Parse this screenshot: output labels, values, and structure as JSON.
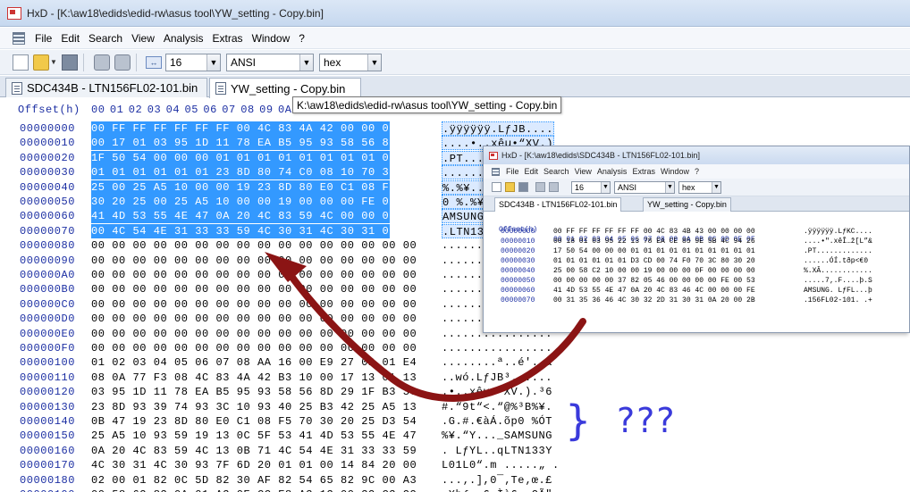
{
  "window": {
    "title": "HxD - [K:\\aw18\\edids\\edid-rw\\asus tool\\YW_setting - Copy.bin]"
  },
  "menu": [
    "File",
    "Edit",
    "Search",
    "View",
    "Analysis",
    "Extras",
    "Window",
    "?"
  ],
  "toolbar": {
    "bytes_per_row": "16",
    "charset": "ANSI",
    "display_mode": "hex"
  },
  "tabs": [
    {
      "label": "SDC434B - LTN156FL02-101.bin",
      "active": false
    },
    {
      "label": "YW_setting - Copy.bin",
      "active": true
    }
  ],
  "tooltip": "K:\\aw18\\edids\\edid-rw\\asus tool\\YW_setting - Copy.bin",
  "hex_view": {
    "offset_header": "Offset(h)",
    "column_headers": [
      "00",
      "01",
      "02",
      "03",
      "04",
      "05",
      "06",
      "07",
      "08",
      "09",
      "0A",
      "0B",
      "0C",
      "0D",
      "0E",
      "0F"
    ],
    "rows": [
      {
        "offset": "00000000",
        "bytes": "00 FF FF FF FF FF FF 00 4C 83 4A 42 00 00 00 00",
        "ascii": ".ÿÿÿÿÿÿ.LƒJB....",
        "selected": true
      },
      {
        "offset": "00000010",
        "bytes": "00 17 01 03 95 1D 11 78 EA B5 95 93 58 56 8D 29",
        "ascii": "....•..xêµ•“XV.)",
        "selected": true
      },
      {
        "offset": "00000020",
        "bytes": "1F 50 54 00 00 00 01 01 01 01 01 01 01 01 01 01",
        "ascii": ".PT.............",
        "selected": true
      },
      {
        "offset": "00000030",
        "bytes": "01 01 01 01 01 01 23 8D 80 74 C0 08 10 70 30 20",
        "ascii": "......#.€tÀ..p0 ",
        "selected": true
      },
      {
        "offset": "00000040",
        "bytes": "25 00 25 A5 10 00 00 19 23 8D 80 E0 C1 08 F5 70",
        "ascii": "%.%¥....#.€àÁ.õp",
        "selected": true
      },
      {
        "offset": "00000050",
        "bytes": "30 20 25 00 25 A5 10 00 00 19 00 00 00 FE 00 53",
        "ascii": "0 %.%¥.......þ.S",
        "selected": true
      },
      {
        "offset": "00000060",
        "bytes": "41 4D 53 55 4E 47 0A 20 4C 83 59 4C 00 00 00 FE",
        "ascii": "AMSUNG. LƒYL...þ",
        "selected": true
      },
      {
        "offset": "00000070",
        "bytes": "00 4C 54 4E 31 33 33 59 4C 30 31 4C 30 31 00 6D",
        "ascii": ".LTN133YL01L01.m",
        "selected": true
      },
      {
        "offset": "00000080",
        "bytes": "00 00 00 00 00 00 00 00 00 00 00 00 00 00 00 00",
        "ascii": "................",
        "selected": false
      },
      {
        "offset": "00000090",
        "bytes": "00 00 00 00 00 00 00 00 00 00 00 00 00 00 00 00",
        "ascii": "................",
        "selected": false
      },
      {
        "offset": "000000A0",
        "bytes": "00 00 00 00 00 00 00 00 00 00 00 00 00 00 00 00",
        "ascii": "................",
        "selected": false
      },
      {
        "offset": "000000B0",
        "bytes": "00 00 00 00 00 00 00 00 00 00 00 00 00 00 00 00",
        "ascii": "................",
        "selected": false
      },
      {
        "offset": "000000C0",
        "bytes": "00 00 00 00 00 00 00 00 00 00 00 00 00 00 00 00",
        "ascii": "................",
        "selected": false
      },
      {
        "offset": "000000D0",
        "bytes": "00 00 00 00 00 00 00 00 00 00 00 00 00 00 00 00",
        "ascii": "................",
        "selected": false
      },
      {
        "offset": "000000E0",
        "bytes": "00 00 00 00 00 00 00 00 00 00 00 00 00 00 00 00",
        "ascii": "................",
        "selected": false
      },
      {
        "offset": "000000F0",
        "bytes": "00 00 00 00 00 00 00 00 00 00 00 00 00 00 00 00",
        "ascii": "................",
        "selected": false
      },
      {
        "offset": "00000100",
        "bytes": "01 02 03 04 05 06 07 08 AA 16 00 E9 27 02 01 E4",
        "ascii": "........ª..é'..ä",
        "selected": false
      },
      {
        "offset": "00000110",
        "bytes": "08 0A 77 F3 08 4C 83 4A 42 B3 10 00 17 13 01 13",
        "ascii": "..wó.LƒJB³......",
        "selected": false
      },
      {
        "offset": "00000120",
        "bytes": "03 95 1D 11 78 EA B5 95 93 58 56 8D 29 1F B3 36",
        "ascii": ".•..xêµ•“XV.).³6",
        "selected": false
      },
      {
        "offset": "00000130",
        "bytes": "23 8D 93 39 74 93 3C 10 93 40 25 B3 42 25 A5 13",
        "ascii": "#.“9t“<.“@%³B%¥.",
        "selected": false
      },
      {
        "offset": "00000140",
        "bytes": "0B 47 19 23 8D 80 E0 C1 08 F5 70 30 20 25 D3 54",
        "ascii": ".G.#.€àÁ.õp0 %ÓT",
        "selected": false
      },
      {
        "offset": "00000150",
        "bytes": "25 A5 10 93 59 19 13 0C 5F 53 41 4D 53 55 4E 47",
        "ascii": "%¥.“Y..._SAMSUNG",
        "selected": false
      },
      {
        "offset": "00000160",
        "bytes": "0A 20 4C 83 59 4C 13 0B 71 4C 54 4E 31 33 33 59",
        "ascii": ". LƒYL..qLTN133Y",
        "selected": false
      },
      {
        "offset": "00000170",
        "bytes": "4C 30 31 4C 30 93 7F 6D 20 01 01 00 14 84 20 00",
        "ascii": "L01L0“.m .....„ .",
        "selected": false
      },
      {
        "offset": "00000180",
        "bytes": "02 00 01 82 0C 5D 82 30 AF 82 54 65 82 9C 00 A3",
        "ascii": "...‚.],0¯‚Te‚œ.£",
        "selected": false
      },
      {
        "offset": "00000190",
        "bytes": "00 58 62 83 0A 01 A3 0E CC E8 A3 13 00 32 C3 22",
        "ascii": ".Xbƒ..£.Ìè£..2Ã\"",
        "selected": false
      }
    ]
  },
  "inset_window": {
    "title": "HxD - [K:\\aw18\\edids\\SDC434B - LTN156FL02-101.bin]",
    "menu": [
      "File",
      "Edit",
      "Search",
      "View",
      "Analysis",
      "Extras",
      "Window",
      "?"
    ],
    "bytes_per_row": "16",
    "charset": "ANSI",
    "display_mode": "hex",
    "tabs": [
      "SDC434B - LTN156FL02-101.bin",
      "YW_setting - Copy.bin"
    ],
    "offset_header": "Offset(h)",
    "column_header_line": "00 01 02 03 04 05 06 07 08 09 0A 0B 0C 0D 0E 0F",
    "rows": [
      {
        "offset": "00000000",
        "bytes": "00 FF FF FF FF FF FF 00 4C 83 4B 43 00 00 00 00",
        "ascii": ".ÿÿÿÿÿÿ.LƒKC...."
      },
      {
        "offset": "00000010",
        "bytes": "00 18 01 03 95 22 13 78 EA CE 85 9E 5B 4C 94 26",
        "ascii": "....•\".xêÎ…ž[L”&"
      },
      {
        "offset": "00000020",
        "bytes": "17 50 54 00 00 00 01 01 01 01 01 01 01 01 01 01",
        "ascii": ".PT............."
      },
      {
        "offset": "00000030",
        "bytes": "01 01 01 01 01 01 D3 CD 00 74 F0 70 3C 80 30 20",
        "ascii": "......ÓÍ.tðp<€0 "
      },
      {
        "offset": "00000040",
        "bytes": "25 00 58 C2 10 00 00 19 00 00 00 0F 00 00 00 00",
        "ascii": "%.XÂ............"
      },
      {
        "offset": "00000050",
        "bytes": "00 00 00 00 00 37 82 05 46 00 00 00 00 FE 00 53",
        "ascii": ".....7‚.F....þ.S"
      },
      {
        "offset": "00000060",
        "bytes": "41 4D 53 55 4E 47 0A 20 4C 83 46 4C 00 00 00 FE",
        "ascii": "AMSUNG. LƒFL...þ"
      },
      {
        "offset": "00000070",
        "bytes": "00 31 35 36 46 4C 30 32 2D 31 30 31 0A 20 00 2B",
        "ascii": ".156FL02-101. .+"
      }
    ]
  },
  "annotation": {
    "brace": "}",
    "text": "???"
  }
}
